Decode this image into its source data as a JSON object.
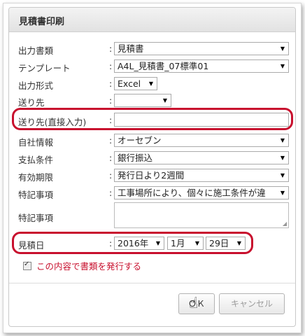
{
  "dialog": {
    "title": "見積書印刷",
    "rows": {
      "output_doc": {
        "label": "出力書類",
        "value": "見積書"
      },
      "template": {
        "label": "テンプレート",
        "value": "A4L_見積書_07標準01"
      },
      "output_format": {
        "label": "出力形式",
        "value": "Excel"
      },
      "recipient": {
        "label": "送り先",
        "value": ""
      },
      "recipient_direct": {
        "label": "送り先(直接入力)",
        "value": ""
      },
      "company_info": {
        "label": "自社情報",
        "value": "オーセブン"
      },
      "payment_terms": {
        "label": "支払条件",
        "value": "銀行振込"
      },
      "valid_until": {
        "label": "有効期限",
        "value": "発行日より2週間"
      },
      "notes1": {
        "label": "特記事項",
        "value": "工事場所により、個々に施工条件が違"
      },
      "notes2": {
        "label": "特記事項",
        "value": ""
      },
      "quote_date": {
        "label": "見積日",
        "year": "2016年",
        "month": "1月",
        "day": "29日"
      }
    },
    "colon": ":",
    "arrow": "▼",
    "checkbox": {
      "label": "この内容で書類を発行する",
      "checked": true
    },
    "buttons": {
      "ok": "ＯＫ",
      "cancel": "キャンセル"
    },
    "accent_color": "#c8102e"
  }
}
